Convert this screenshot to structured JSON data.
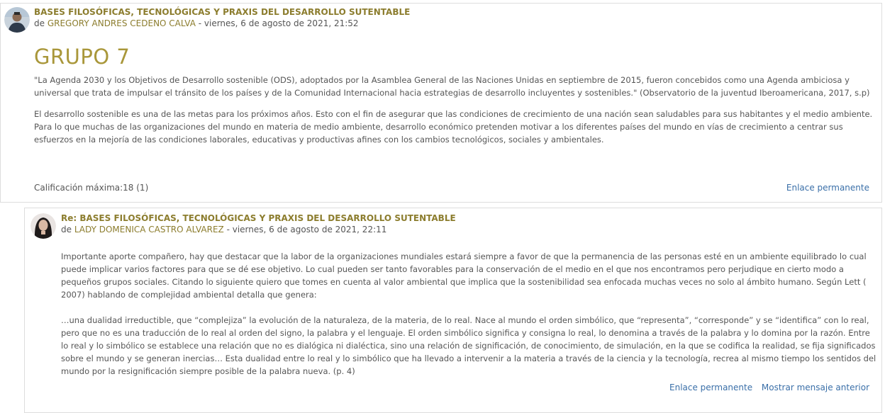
{
  "post1": {
    "subject": "BASES FILOSÓFICAS, TECNOLÓGICAS Y PRAXIS DEL DESARROLLO SUTENTABLE",
    "by_prefix": "de ",
    "author": "GREGORY ANDRES CEDENO CALVA",
    "date": " - viernes, 6 de agosto de 2021, 21:52",
    "title": "GRUPO 7",
    "para1": "\"La Agenda 2030 y los Objetivos de Desarrollo sostenible (ODS), adoptados por la Asamblea General de las Naciones Unidas en septiembre de 2015, fueron concebidos como una Agenda ambiciosa y universal que trata de impulsar el tránsito de los países y de la Comunidad Internacional hacia estrategias de desarrollo incluyentes y sostenibles.\" (Observatorio de la juventud Iberoamericana, 2017, s.p)",
    "para2": "El desarrollo sostenible es una de las metas para los próximos años. Esto con el fin de asegurar que las condiciones de crecimiento de una nación sean saludables para sus habitantes y el medio ambiente. Para lo que muchas de las organizaciones del mundo en materia de medio ambiente, desarrollo económico pretenden motivar a los diferentes países del mundo en vías de crecimiento a centrar sus esfuerzos en la mejoría de las condiciones laborales, educativas y productivas afines con los cambios tecnológicos, sociales y ambientales.",
    "rating": "Calificación máxima:18 (1)",
    "permalink": "Enlace permanente"
  },
  "post2": {
    "subject": "Re: BASES FILOSÓFICAS, TECNOLÓGICAS Y PRAXIS DEL DESARROLLO SUTENTABLE",
    "by_prefix": "de ",
    "author": "LADY DOMENICA CASTRO ALVAREZ",
    "date": " - viernes, 6 de agosto de 2021, 22:11",
    "para1": "Importante aporte compañero, hay que destacar que la labor de la organizaciones mundiales estará siempre a favor de que la permanencia de las personas esté en un ambiente equilibrado lo cual puede implicar varios factores para que se dé ese objetivo. Lo cual pueden ser tanto favorables para la conservación de el medio en el que nos encontramos pero perjudique en cierto modo a pequeños grupos sociales. Citando lo siguiente quiero que tomes en cuenta al valor ambiental que implica que la sostenibilidad sea enfocada muchas veces no solo al ámbito humano. Según Lett ( 2007) hablando de complejidad ambiental detalla que genera:",
    "para2": "…una dualidad irreductible, que “complejiza” la evolución de la naturaleza, de la materia, de lo real. Nace al mundo el orden simbólico, que “representa”, “corresponde” y se “identifica” con lo real, pero que no es una traducción de lo real al orden del signo, la palabra y el lenguaje. El orden simbólico significa y consigna lo real, lo denomina a través de la palabra y lo domina por la razón. Entre lo real y lo simbólico se establece una relación que no es dialógica ni dialéctica, sino una relación de significación, de conocimiento, de simulación, en la que se codifica la realidad, se fija significados sobre el mundo y se generan inercias… Esta dualidad entre lo real y lo simbólico que ha llevado a intervenir a la materia a través de la ciencia y la tecnología, recrea al mismo tiempo los sentidos del mundo por la resignificación siempre posible de la palabra nueva. (p. 4)",
    "permalink": "Enlace permanente",
    "show_parent": "Mostrar mensaje anterior"
  },
  "colors": {
    "subject": "#8c7d2e",
    "title": "#a9973a",
    "link": "#3a6fa8",
    "border": "#dddddd"
  }
}
